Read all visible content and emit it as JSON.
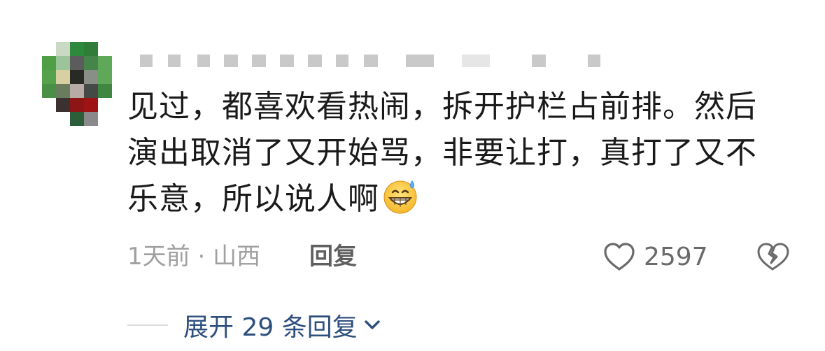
{
  "comment": {
    "avatar": {
      "colors": [
        [
          "#ffffff",
          "#c9d9c4",
          "#2d8a3d",
          "#2f7d39",
          "#ffffff"
        ],
        [
          "#4f9f47",
          "#9cc49b",
          "#5c5c5c",
          "#45854b",
          "#5fa85a"
        ],
        [
          "#56a14c",
          "#d8d0a2",
          "#2a2a25",
          "#8a8f86",
          "#5fa85a"
        ],
        [
          "#4a8f46",
          "#6a7c5e",
          "#b8aba6",
          "#444a46",
          "#3f8740"
        ],
        [
          "#ffffff",
          "#3b3131",
          "#8d1515",
          "#9e1414",
          "#ffffff"
        ],
        [
          "#ffffff",
          "#ffffff",
          "#2d5e3a",
          "#8a8a8a",
          "#ffffff"
        ]
      ]
    },
    "content_lines": [
      "见过，都喜欢看热闹，拆开护栏占前排。然后",
      "演出取消了又开始骂，非要让打，真打了又不",
      "乐意，所以说人啊"
    ],
    "emoji": "grinning-face-with-sweat-icon",
    "time": "1天前",
    "separator": "·",
    "location": "山西",
    "reply_label": "回复",
    "like_count": "2597",
    "expand_label": "展开 29 条回复",
    "accent_color": "#2e4f7d"
  }
}
